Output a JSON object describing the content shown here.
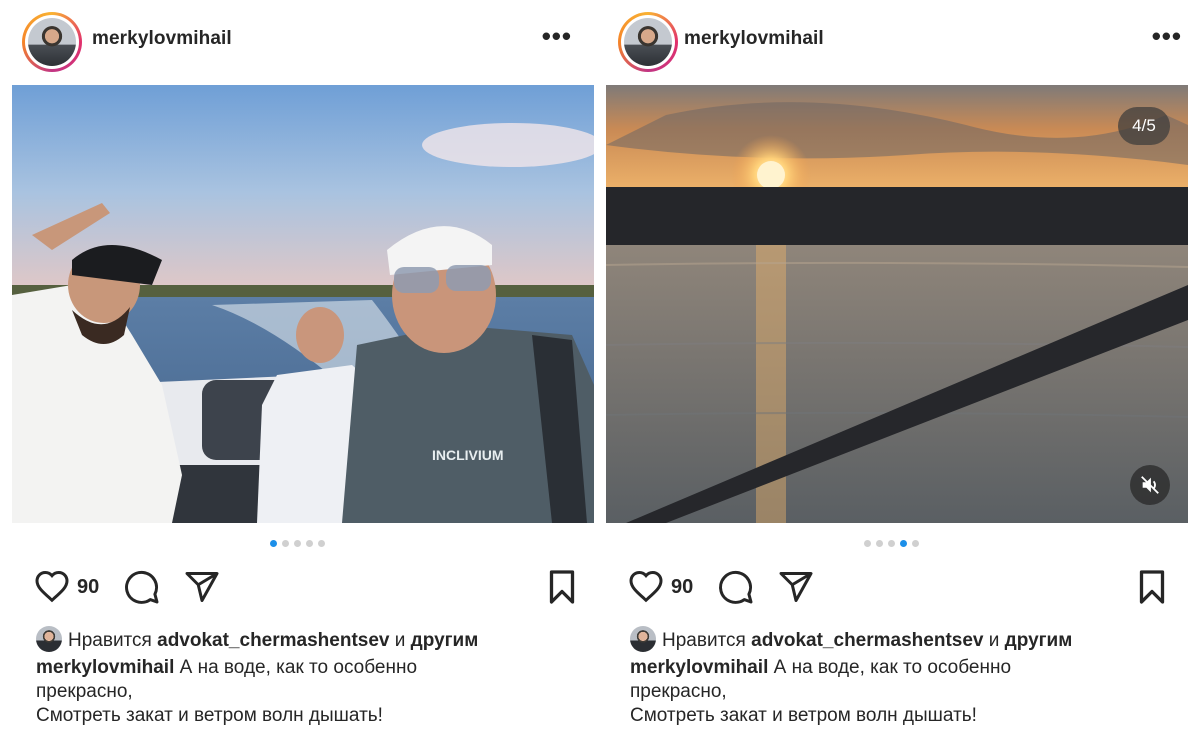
{
  "posts": [
    {
      "username": "merkylovmihail",
      "more_label": "•••",
      "likes": "90",
      "liked_by_prefix": "Нравится",
      "liked_by_user": "advokat_chermashentsev",
      "liked_by_and": "и",
      "liked_by_others": "другим",
      "caption_user": "merkylovmihail",
      "caption_line1": "А на воде, как то особенно",
      "caption_line2": "прекрасно,",
      "caption_line3": "Смотреть закат и ветром волн дышать!",
      "carousel": {
        "total": 5,
        "active": 1
      },
      "media_type": "photo"
    },
    {
      "username": "merkylovmihail",
      "more_label": "•••",
      "likes": "90",
      "liked_by_prefix": "Нравится",
      "liked_by_user": "advokat_chermashentsev",
      "liked_by_and": "и",
      "liked_by_others": "другим",
      "caption_user": "merkylovmihail",
      "caption_line1": "А на воде, как то особенно",
      "caption_line2": "прекрасно,",
      "caption_line3": "Смотреть закат и ветром волн дышать!",
      "carousel": {
        "total": 5,
        "active": 4
      },
      "counter": "4/5",
      "media_type": "video"
    }
  ],
  "icons": {
    "like": "heart-icon",
    "comment": "comment-icon",
    "share": "send-icon",
    "save": "bookmark-icon",
    "mute": "speaker-muted-icon"
  },
  "colors": {
    "carousel_active": "#1c8fe9",
    "carousel_inactive": "#d0d0d0",
    "text": "#262626"
  }
}
